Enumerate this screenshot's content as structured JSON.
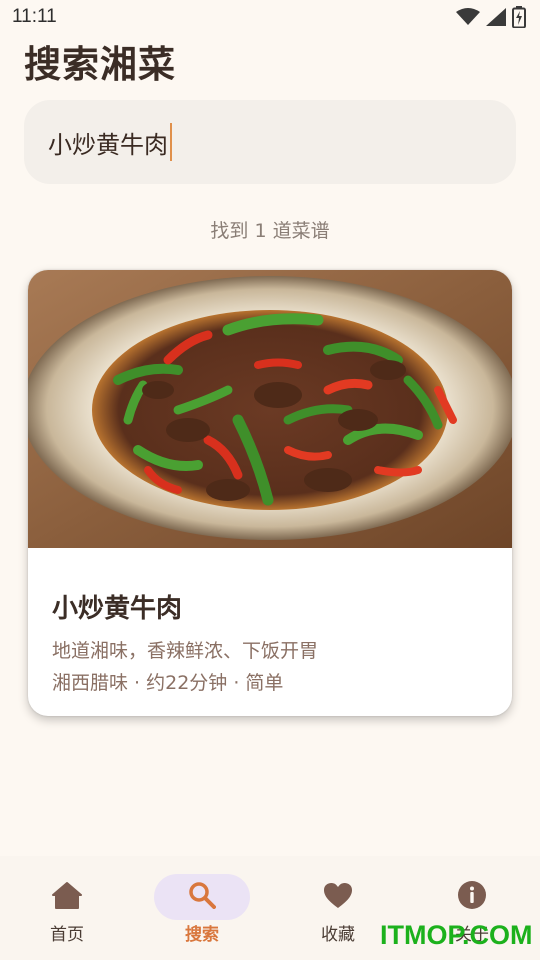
{
  "status_bar": {
    "time": "11:11",
    "icons": [
      "wifi-icon",
      "signal-icon",
      "battery-icon"
    ]
  },
  "page": {
    "title": "搜索湘菜"
  },
  "search": {
    "value": "小炒黄牛肉"
  },
  "results": {
    "count_text": "找到 1 道菜谱"
  },
  "recipes": [
    {
      "name": "小炒黄牛肉",
      "description": "地道湘味，香辣鲜浓、下饭开胃",
      "meta": "湘西腊味 · 约22分钟 · 简单",
      "image": "stir-fried-beef-with-chili-photo"
    }
  ],
  "bottom_nav": {
    "items": [
      {
        "label": "首页",
        "icon": "home-icon"
      },
      {
        "label": "搜索",
        "icon": "search-icon",
        "active": true
      },
      {
        "label": "收藏",
        "icon": "heart-icon"
      },
      {
        "label": "关于",
        "icon": "info-icon"
      }
    ]
  },
  "watermark": "ITMOP.COM",
  "colors": {
    "background": "#fdf8f2",
    "accent": "#d9773d",
    "active_pill": "#ebe3f5",
    "watermark": "#1cb11c"
  }
}
